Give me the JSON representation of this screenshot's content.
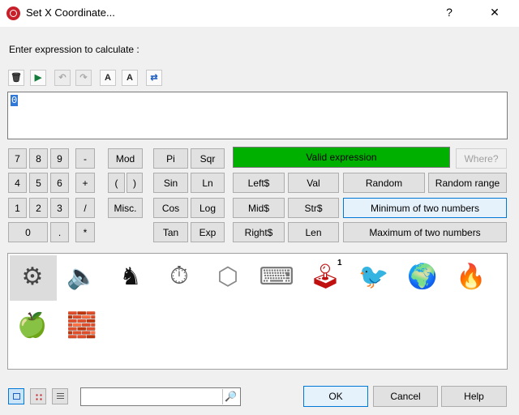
{
  "window": {
    "title": "Set X Coordinate...",
    "help_glyph": "?",
    "close_glyph": "✕"
  },
  "prompt": "Enter expression to calculate :",
  "toolbar": [
    {
      "name": "delete-button",
      "glyph": "🗑",
      "enabled": true
    },
    {
      "name": "insert-button",
      "glyph": "▶",
      "enabled": true
    },
    {
      "name": "undo-button",
      "glyph": "↶",
      "enabled": false
    },
    {
      "name": "redo-button",
      "glyph": "↷",
      "enabled": false
    },
    {
      "name": "font-smaller-button",
      "glyph": "A",
      "enabled": true
    },
    {
      "name": "font-larger-button",
      "glyph": "A",
      "enabled": true
    },
    {
      "name": "wrap-button",
      "glyph": "⇄",
      "enabled": true
    }
  ],
  "expression": {
    "value": "0"
  },
  "keypad": {
    "rows": [
      [
        "7",
        "8",
        "9",
        "-"
      ],
      [
        "4",
        "5",
        "6",
        "+"
      ],
      [
        "1",
        "2",
        "3",
        "/"
      ],
      [
        "0",
        ".",
        "*"
      ]
    ]
  },
  "ops": {
    "mod": "Mod",
    "paren_open": "(",
    "paren_close": ")",
    "misc": "Misc."
  },
  "funcs": {
    "pi": "Pi",
    "sqr": "Sqr",
    "sin": "Sin",
    "ln": "Ln",
    "cos": "Cos",
    "log": "Log",
    "tan": "Tan",
    "exp": "Exp"
  },
  "strfuncs": {
    "left": "Left$",
    "val": "Val",
    "mid": "Mid$",
    "str": "Str$",
    "right": "Right$",
    "len": "Len"
  },
  "status": {
    "text": "Valid expression",
    "color": "#00b000"
  },
  "where": "Where?",
  "random": {
    "random": "Random",
    "random_range": "Random range",
    "min": "Minimum of two numbers",
    "max": "Maximum of two numbers"
  },
  "objects": [
    {
      "name": "gears-icon",
      "glyph": "⚙"
    },
    {
      "name": "speaker-icon",
      "glyph": "🔈"
    },
    {
      "name": "chess-icon",
      "glyph": "♞"
    },
    {
      "name": "timer-icon",
      "glyph": "⏱"
    },
    {
      "name": "box-icon",
      "glyph": "⬡"
    },
    {
      "name": "keyboard-mouse-icon",
      "glyph": "⌨"
    },
    {
      "name": "joystick-icon",
      "glyph": "🕹",
      "badge": "1"
    },
    {
      "name": "sprite-character-icon",
      "glyph": "🐦"
    },
    {
      "name": "planet-icon",
      "glyph": "🌍"
    },
    {
      "name": "fire-icon",
      "glyph": "🔥"
    },
    {
      "name": "apple-icon",
      "glyph": "🍏"
    },
    {
      "name": "bricks-icon",
      "glyph": "🧱"
    }
  ],
  "bottom": {
    "search_glyph": "🔎",
    "ok": "OK",
    "cancel": "Cancel",
    "help": "Help"
  }
}
